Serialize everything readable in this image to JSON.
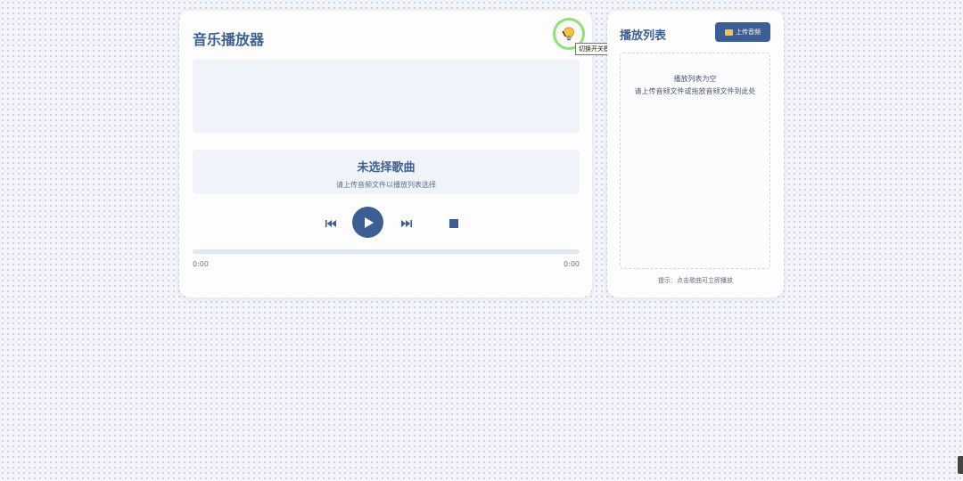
{
  "player": {
    "title": "音乐播放器",
    "theme_tooltip": "切换开关模式",
    "track_title": "未选择歌曲",
    "track_sub": "请上传音频文件以播放列表选择",
    "time_current": "0:00",
    "time_total": "0:00",
    "progress": 0,
    "icons": {
      "theme": "lightbulb-icon",
      "prev": "skip-back-icon",
      "play": "play-icon",
      "next": "skip-forward-icon",
      "stop": "stop-icon"
    }
  },
  "playlist": {
    "title": "播放列表",
    "upload_label": "上传音频",
    "upload_icon": "folder-icon",
    "empty_line1": "播放列表为空",
    "empty_line2": "请上传音频文件或拖放音频文件到此处",
    "hint": "提示：点击歌曲可立即播放"
  },
  "colors": {
    "accent": "#3d5e94",
    "ring": "#8fe07c",
    "background": "#f3f5fa"
  }
}
